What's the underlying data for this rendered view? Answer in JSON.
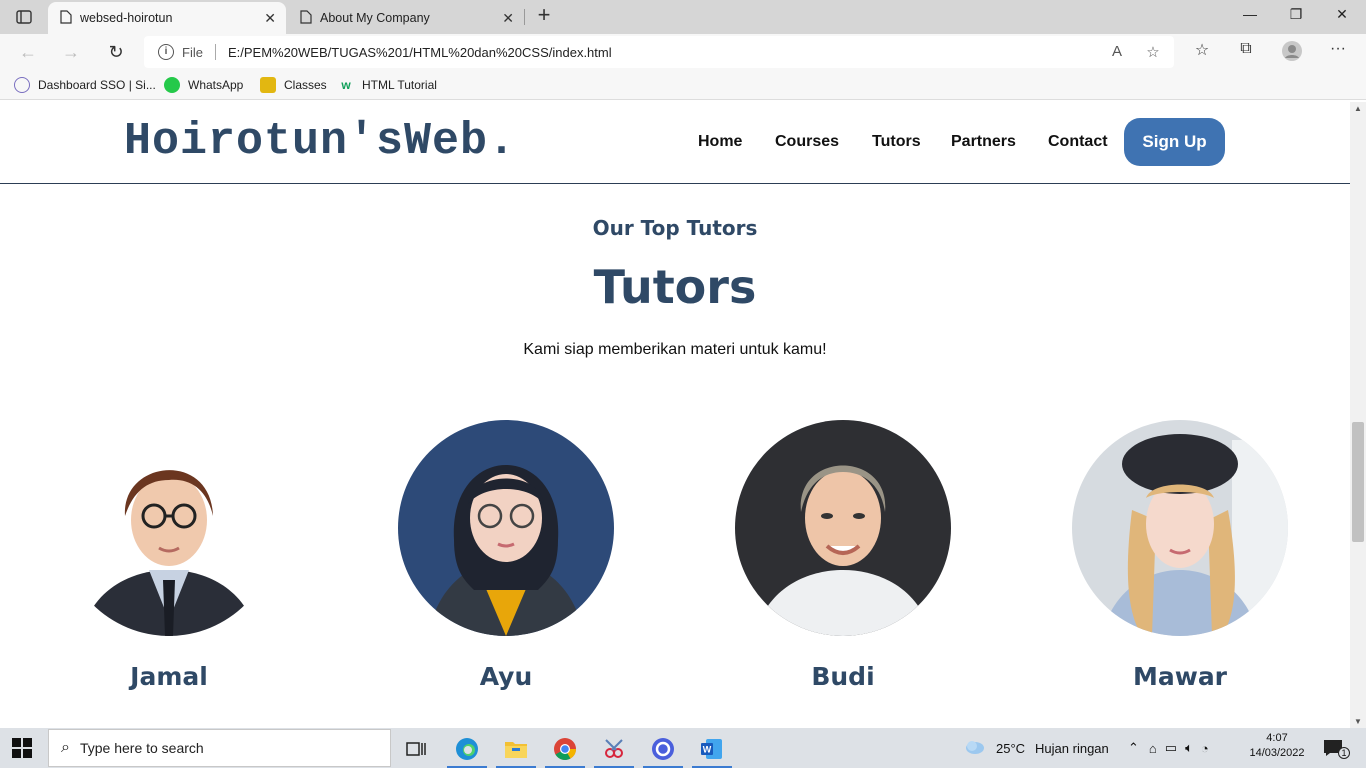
{
  "browser": {
    "tabs": [
      {
        "title": "websed-hoirotun",
        "active": true
      },
      {
        "title": "About My Company",
        "active": false
      }
    ],
    "address": {
      "scheme_label": "File",
      "url": "E:/PEM%20WEB/TUGAS%201/HTML%20dan%20CSS/index.html"
    },
    "bookmarks": [
      {
        "label": "Dashboard SSO | Si...",
        "icon": "sso-icon"
      },
      {
        "label": "WhatsApp",
        "icon": "whatsapp-icon"
      },
      {
        "label": "Classes",
        "icon": "classroom-icon"
      },
      {
        "label": "HTML Tutorial",
        "icon": "w3schools-icon"
      }
    ]
  },
  "site": {
    "logo": "Hoirotun'sWeb.",
    "nav": [
      "Home",
      "Courses",
      "Tutors",
      "Partners",
      "Contact"
    ],
    "signup": "Sign Up",
    "section": {
      "subtitle": "Our Top Tutors",
      "title": "Tutors",
      "description": "Kami siap memberikan materi untuk kamu!"
    },
    "tutors": [
      {
        "name": "Jamal"
      },
      {
        "name": "Ayu"
      },
      {
        "name": "Budi"
      },
      {
        "name": "Mawar"
      }
    ]
  },
  "taskbar": {
    "search_placeholder": "Type here to search",
    "weather": {
      "temp": "25°C",
      "condition": "Hujan ringan"
    },
    "time": "4:07",
    "date": "14/03/2022",
    "notification_count": "1"
  },
  "colors": {
    "accent": "#3f73b2",
    "heading": "#2f4966"
  }
}
